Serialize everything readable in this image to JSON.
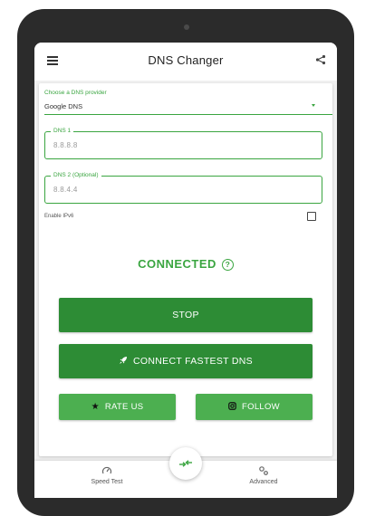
{
  "app": {
    "title": "DNS Changer"
  },
  "provider": {
    "label": "Choose a DNS provider",
    "value": "Google DNS"
  },
  "dns1": {
    "label": "DNS 1",
    "value": "8.8.8.8"
  },
  "dns2": {
    "label": "DNS 2 (Optional)",
    "value": "8.8.4.4"
  },
  "ipv6": {
    "label": "Enable IPv6",
    "checked": false
  },
  "status": {
    "text": "CONNECTED",
    "help_glyph": "?"
  },
  "buttons": {
    "stop": "STOP",
    "fastest": "CONNECT FASTEST DNS",
    "rate": "RATE US",
    "follow": "FOLLOW"
  },
  "nav": {
    "speed_test": "Speed Test",
    "advanced": "Advanced"
  },
  "icons": {
    "menu": "menu-icon",
    "share": "share-icon",
    "rocket": "rocket-icon",
    "star": "star-icon",
    "instagram": "instagram-icon",
    "speedometer": "speedometer-icon",
    "gears": "gears-icon",
    "connect": "connect-arrows-icon"
  },
  "colors": {
    "accent": "#3aa540",
    "button_dark": "#2d8c35",
    "button_light": "#4caf50"
  }
}
